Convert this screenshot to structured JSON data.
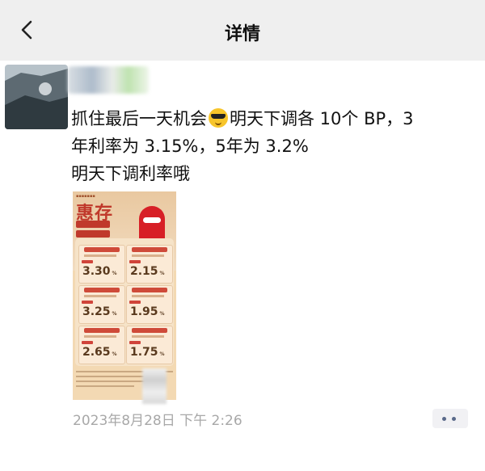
{
  "header": {
    "title": "详情"
  },
  "post": {
    "text_lines": [
      "抓住最后一天机会",
      "明天下调各 10个 BP，3",
      "年利率为 3.15%，5年为 3.2%",
      "明天下调利率哦"
    ],
    "emoji_icon": "sunglasses-emoji-icon",
    "timestamp": "2023年8月28日 下午 2:26"
  },
  "poster": {
    "heading": "惠存",
    "rates": [
      "3.30",
      "2.15",
      "3.25",
      "1.95",
      "2.65",
      "1.75"
    ],
    "percent_sign": "%"
  },
  "colors": {
    "topbar": "#efefef",
    "poster_red": "#c0392b",
    "time_gray": "#a8a8a8",
    "more_dots": "#5a6a8a"
  }
}
